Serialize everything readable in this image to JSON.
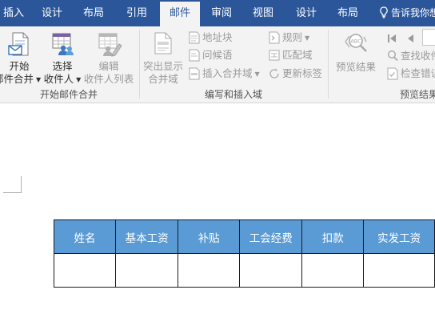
{
  "tabs": [
    {
      "label": "插入",
      "active": false
    },
    {
      "label": "设计",
      "active": false
    },
    {
      "label": "布局",
      "active": false
    },
    {
      "label": "引用",
      "active": false
    },
    {
      "label": "邮件",
      "active": true
    },
    {
      "label": "审阅",
      "active": false
    },
    {
      "label": "视图",
      "active": false
    },
    {
      "label": "设计",
      "active": false
    },
    {
      "label": "布局",
      "active": false
    }
  ],
  "tell_me": "告诉我你想",
  "ribbon": {
    "start_group": {
      "label": "开始邮件合并",
      "start_merge": {
        "line1": "开始",
        "line2": "邮件合并"
      },
      "select_recipients": {
        "line1": "选择",
        "line2": "收件人"
      },
      "edit_recipients": {
        "line1": "编辑",
        "line2": "收件人列表"
      }
    },
    "write_group": {
      "label": "编写和插入域",
      "highlight_fields": {
        "line1": "突出显示",
        "line2": "合并域"
      },
      "address_block": "地址块",
      "greeting_line": "问候语",
      "insert_merge_field": "插入合并域",
      "rules": "规则",
      "match_fields": "匹配域",
      "update_labels": "更新标签"
    },
    "preview_group": {
      "label": "预览结果",
      "preview_results": "预览结果",
      "find_recipient": "查找收件",
      "check_errors": "检查错误"
    }
  },
  "table": {
    "headers": [
      "姓名",
      "基本工资",
      "补贴",
      "工会经费",
      "扣款",
      "实发工资"
    ]
  },
  "colors": {
    "tab_bar": "#2b579a",
    "ribbon": "#f3f3f3",
    "table_header": "#5b9bd5"
  }
}
